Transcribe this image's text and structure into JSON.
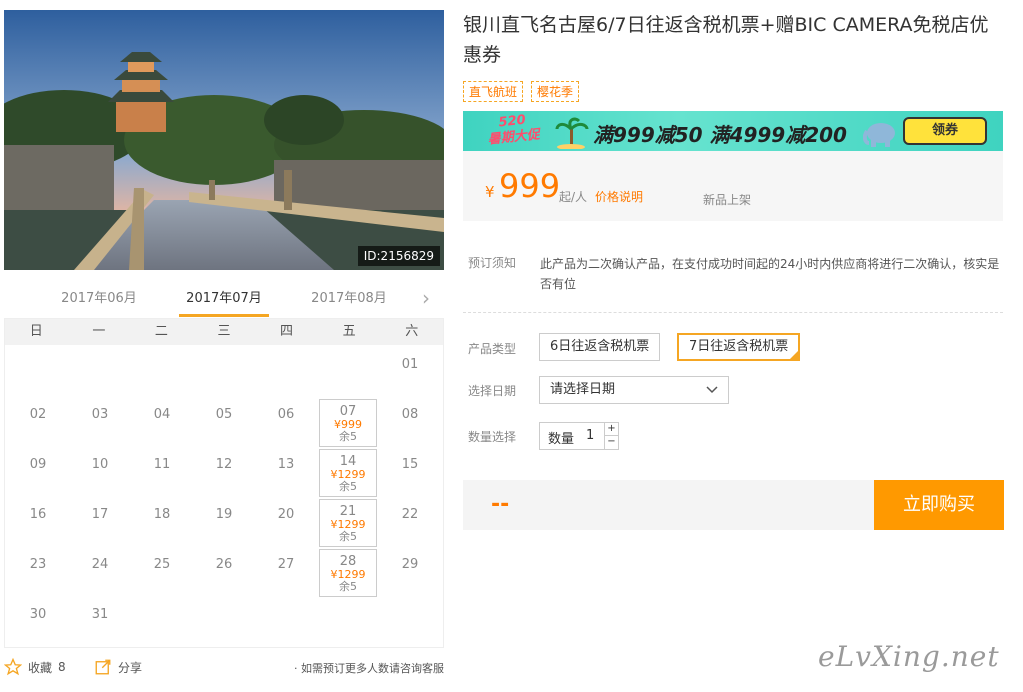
{
  "product": {
    "title": "银川直飞名古屋6/7日往返含税机票+赠BIC CAMERA免税店优惠券",
    "tags": [
      "直飞航班",
      "樱花季"
    ],
    "image_id": "ID:2156829"
  },
  "banner": {
    "badge_line1": "520",
    "badge_line2": "暑期大促",
    "text": "满999减50 满4999减200",
    "button": "领券"
  },
  "price": {
    "currency": "¥",
    "amount": "999",
    "per": "起/人",
    "explain_link": "价格说明",
    "status": "新品上架"
  },
  "notice": {
    "label": "预订须知",
    "text": "此产品为二次确认产品，在支付成功时间起的24小时内供应商将进行二次确认，核实是否有位"
  },
  "options": {
    "type_label": "产品类型",
    "types": [
      "6日往返含税机票",
      "7日往返含税机票"
    ],
    "date_label": "选择日期",
    "date_placeholder": "请选择日期",
    "qty_label": "数量选择",
    "qty_inner": "数量",
    "qty_value": "1",
    "plus": "+",
    "minus": "−"
  },
  "buy": {
    "total": "--",
    "button": "立即购买"
  },
  "calendar": {
    "months": [
      "2017年06月",
      "2017年07月",
      "2017年08月"
    ],
    "next": "›",
    "weekdays": [
      "日",
      "一",
      "二",
      "三",
      "四",
      "五",
      "六"
    ],
    "days": [
      {
        "d": "01",
        "col": 6,
        "row": 0
      },
      {
        "d": "02",
        "col": 0,
        "row": 1
      },
      {
        "d": "03",
        "col": 1,
        "row": 1
      },
      {
        "d": "04",
        "col": 2,
        "row": 1
      },
      {
        "d": "05",
        "col": 3,
        "row": 1
      },
      {
        "d": "06",
        "col": 4,
        "row": 1
      },
      {
        "d": "07",
        "col": 5,
        "row": 1,
        "price": "¥999",
        "rest": "余5"
      },
      {
        "d": "08",
        "col": 6,
        "row": 1
      },
      {
        "d": "09",
        "col": 0,
        "row": 2
      },
      {
        "d": "10",
        "col": 1,
        "row": 2
      },
      {
        "d": "11",
        "col": 2,
        "row": 2
      },
      {
        "d": "12",
        "col": 3,
        "row": 2
      },
      {
        "d": "13",
        "col": 4,
        "row": 2
      },
      {
        "d": "14",
        "col": 5,
        "row": 2,
        "price": "¥1299",
        "rest": "余5"
      },
      {
        "d": "15",
        "col": 6,
        "row": 2
      },
      {
        "d": "16",
        "col": 0,
        "row": 3
      },
      {
        "d": "17",
        "col": 1,
        "row": 3
      },
      {
        "d": "18",
        "col": 2,
        "row": 3
      },
      {
        "d": "19",
        "col": 3,
        "row": 3
      },
      {
        "d": "20",
        "col": 4,
        "row": 3
      },
      {
        "d": "21",
        "col": 5,
        "row": 3,
        "price": "¥1299",
        "rest": "余5"
      },
      {
        "d": "22",
        "col": 6,
        "row": 3
      },
      {
        "d": "23",
        "col": 0,
        "row": 4
      },
      {
        "d": "24",
        "col": 1,
        "row": 4
      },
      {
        "d": "25",
        "col": 2,
        "row": 4
      },
      {
        "d": "26",
        "col": 3,
        "row": 4
      },
      {
        "d": "27",
        "col": 4,
        "row": 4
      },
      {
        "d": "28",
        "col": 5,
        "row": 4,
        "price": "¥1299",
        "rest": "余5"
      },
      {
        "d": "29",
        "col": 6,
        "row": 4
      },
      {
        "d": "30",
        "col": 0,
        "row": 5
      },
      {
        "d": "31",
        "col": 1,
        "row": 5
      }
    ]
  },
  "footer": {
    "favorite_label": "收藏",
    "favorite_count": "8",
    "share_label": "分享",
    "note": "· 如需预订更多人数请咨询客服"
  },
  "watermark": "eLvXing.net",
  "colors": {
    "accent": "#ff7a00",
    "button": "#ff9900",
    "tag_border": "#f5a623",
    "banner": "#3fd3c0"
  }
}
